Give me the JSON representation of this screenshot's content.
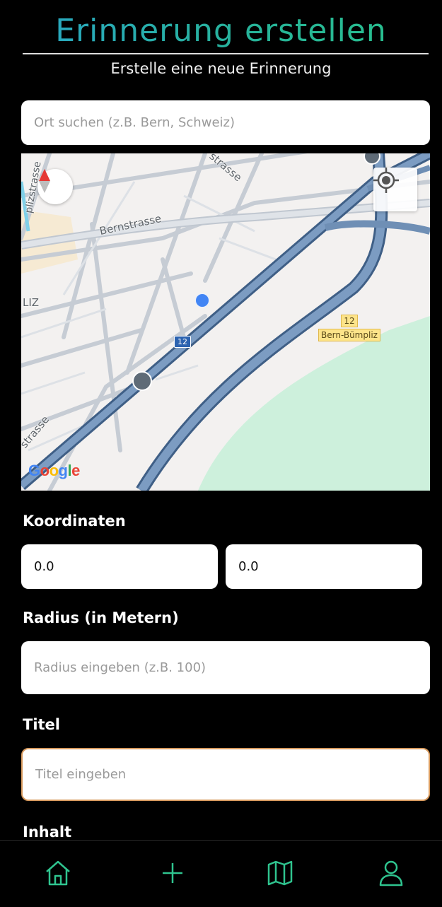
{
  "header": {
    "title": "Erinnerung erstellen",
    "subtitle": "Erstelle eine neue Erinnerung"
  },
  "search": {
    "placeholder": "Ort suchen (z.B. Bern, Schweiz)"
  },
  "map": {
    "labels": {
      "bernstrasse": "Bernstrasse",
      "strasse_top": "strasse",
      "strasse_left": "strasse",
      "plizstrasse": "plizstrasse",
      "liz": "LIZ",
      "highway_number": "12",
      "exit_number": "12",
      "exit_name": "Bern-Bümpliz"
    },
    "logo": "Google",
    "colors": {
      "background": "#f3f1f0",
      "highway": "#5b7fa9",
      "park": "#cdf0dc",
      "location_dot": "#4285f4"
    }
  },
  "coordinates": {
    "label": "Koordinaten",
    "latitude": "0.0",
    "longitude": "0.0"
  },
  "radius": {
    "label": "Radius (in Metern)",
    "placeholder": "Radius eingeben (z.B. 100)"
  },
  "title_field": {
    "label": "Titel",
    "placeholder": "Titel eingeben"
  },
  "content": {
    "label": "Inhalt"
  },
  "nav": {
    "items": [
      {
        "icon": "home-icon"
      },
      {
        "icon": "plus-icon"
      },
      {
        "icon": "map-icon"
      },
      {
        "icon": "user-icon"
      }
    ],
    "color": "#2fc48f"
  }
}
